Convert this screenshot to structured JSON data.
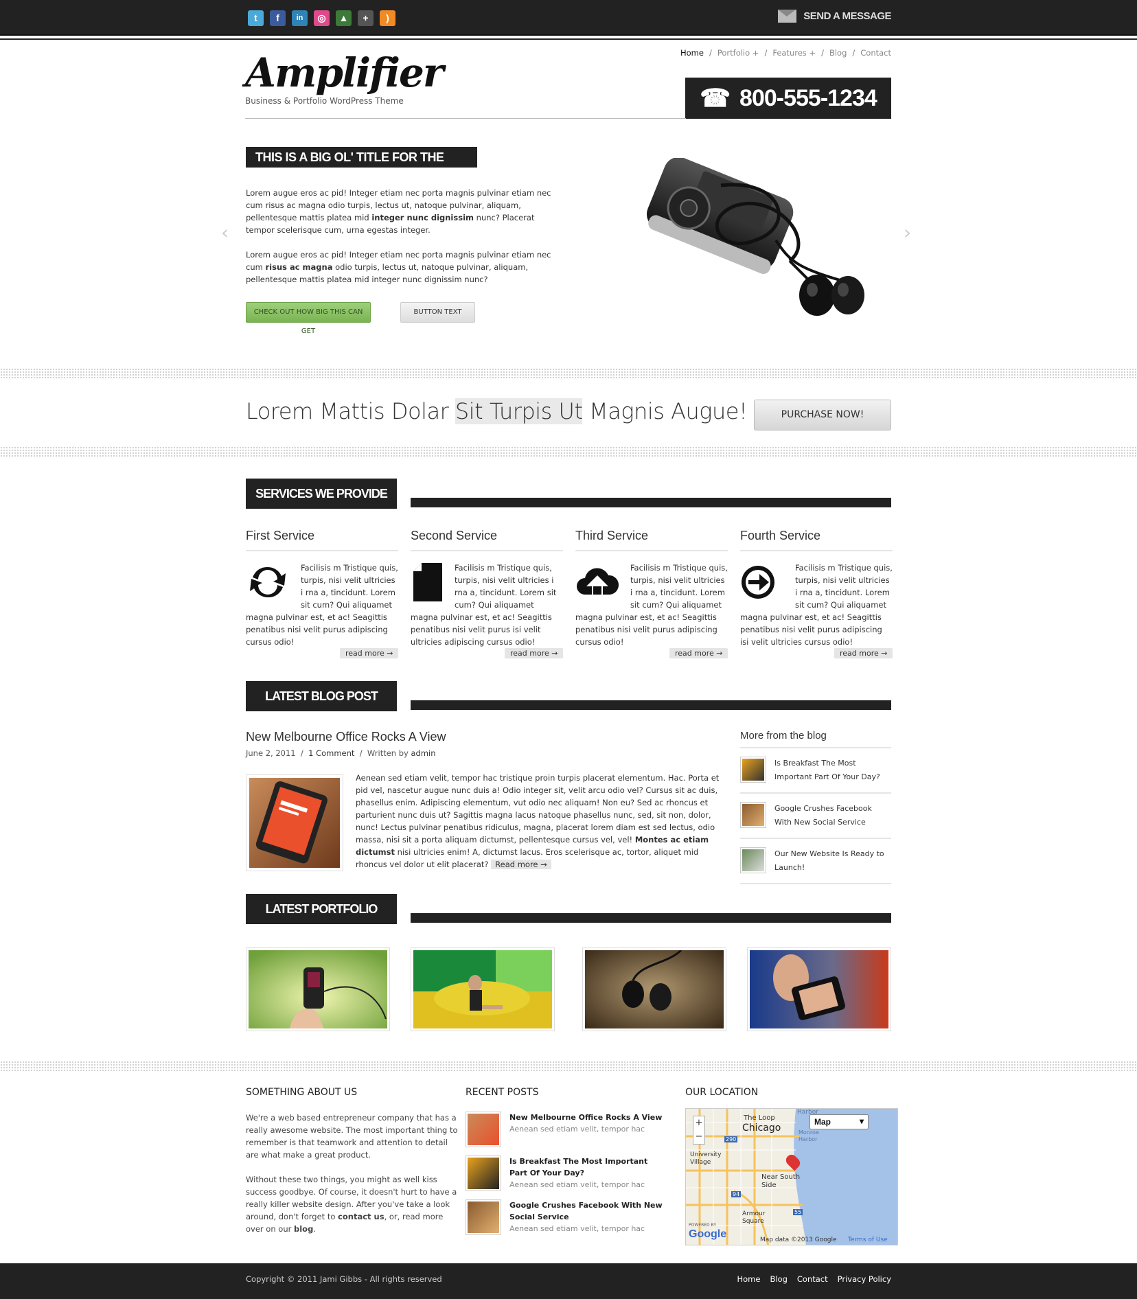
{
  "topbar": {
    "social_icons": [
      "twitter-icon",
      "facebook-icon",
      "linkedin-icon",
      "dribbble-icon",
      "forrst-icon",
      "google-plus-icon",
      "rss-icon"
    ],
    "send_message": "SEND A MESSAGE"
  },
  "header": {
    "logo": "Amplifier",
    "tagline": "Business & Portfolio WordPress Theme",
    "nav": [
      "Home",
      "Portfolio +",
      "Features +",
      "Blog",
      "Contact"
    ],
    "phone": "800-555-1234"
  },
  "slide": {
    "title": "THIS IS A BIG OL' TITLE FOR THE SLIDE",
    "p1a": "Lorem augue eros ac pid! Integer etiam nec porta magnis pulvinar etiam nec cum risus ac magna odio turpis, lectus ut, natoque pulvinar, aliquam, pellentesque mattis platea mid ",
    "p1b": "integer nunc dignissim",
    "p1c": " nunc?  Placerat tempor scelerisque cum, urna egestas integer.",
    "p2a": "Lorem augue eros ac pid! Integer etiam nec porta magnis pulvinar etiam nec cum ",
    "p2b": "risus ac magna",
    "p2c": " odio turpis, lectus ut, natoque pulvinar, aliquam, pellentesque mattis platea mid integer nunc dignissim nunc?",
    "btn_primary": "CHECK OUT HOW BIG THIS CAN GET",
    "btn_secondary": "BUTTON TEXT"
  },
  "promo": {
    "text_a": "Lorem Mattis Dolar ",
    "text_hl": "Sit Turpis Ut",
    "text_b": " Magnis Augue!",
    "button": "PURCHASE NOW!"
  },
  "services": {
    "heading": "SERVICES WE PROVIDE",
    "items": [
      {
        "title": "First Service",
        "text": "Facilisis m Tristique quis, turpis, nisi velit ultricies i rna a, tincidunt. Lorem sit cum? Qui aliquamet magna pulvinar est, et ac! Seagittis penatibus nisi velit purus adipiscing cursus odio!",
        "icon": "refresh-icon"
      },
      {
        "title": "Second Service",
        "text": "Facilisis m Tristique quis, turpis, nisi velit ultricies i rna a, tincidunt. Lorem sit cum? Qui aliquamet magna pulvinar est, et ac! Seagittis penatibus nisi velit purus isi velit ultricies adipiscing cursus odio!",
        "icon": "document-icon"
      },
      {
        "title": "Third Service",
        "text": "Facilisis m Tristique quis, turpis, nisi velit ultricies i rna a, tincidunt. Lorem sit cum? Qui aliquamet magna pulvinar est, et ac! Seagittis penatibus nisi velit purus adipiscing cursus odio!",
        "icon": "cloud-upload-icon"
      },
      {
        "title": "Fourth Service",
        "text": "Facilisis m Tristique quis, turpis, nisi velit ultricies i rna a, tincidunt. Lorem sit cum? Qui aliquamet magna pulvinar est, et ac! Seagittis penatibus nisi velit purus adipiscing isi velit ultricies cursus odio!",
        "icon": "arrow-circle-icon"
      }
    ],
    "read_more": "read more →"
  },
  "blog": {
    "heading": "LATEST BLOG POST",
    "post_title": "New Melbourne Office Rocks A View",
    "date": "June 2, 2011",
    "comments": "1 Comment",
    "written_by": "Written by",
    "author": "admin",
    "body_a": "Aenean sed etiam velit, tempor hac tristique proin turpis placerat elementum. Hac. Porta et pid vel, nascetur augue nunc duis a! Odio integer sit, velit arcu odio vel? Cursus sit ac duis, phasellus enim. Adipiscing elementum, vut odio nec aliquam! Non eu? Sed ac rhoncus et parturient nunc duis ut? Sagittis magna lacus natoque phasellus nunc, sed, sit non, dolor, nunc!  Lectus pulvinar penatibus ridiculus, magna, placerat lorem diam est sed lectus, odio massa, nisi sit a porta aliquam dictumst, pellentesque cursus vel, vel! ",
    "body_b": "Montes ac etiam dictumst",
    "body_c": " nisi ultricies enim! A, dictumst lacus. Eros scelerisque ac, tortor, aliquet mid rhoncus vel dolor ut elit placerat? ",
    "read_more": "Read more →",
    "more_heading": "More from the blog",
    "more_items": [
      "Is Breakfast The Most Important Part Of Your Day?",
      "Google Crushes Facebook With New Social Service",
      "Our New Website Is Ready to Launch!"
    ]
  },
  "portfolio": {
    "heading": "LATEST PORTFOLIO"
  },
  "footer": {
    "about_heading": "SOMETHING ABOUT US",
    "about_p1": "We're a web based entrepreneur company that has a really awesome website. The most important thing to remember is that teamwork and attention to detail are what make a great product.",
    "about_p2a": "Without these two things, you might as well kiss success goodbye. Of course, it doesn't hurt to have a really killer website design. After you've take a look around, don't forget to ",
    "about_p2b": "contact us",
    "about_p2c": ", or, read more over on our ",
    "about_p2d": "blog",
    "about_p2e": ".",
    "recent_heading": "RECENT POSTS",
    "recent": [
      {
        "title": "New Melbourne Office Rocks A View",
        "excerpt": "Aenean sed etiam velit, tempor hac"
      },
      {
        "title": "Is Breakfast The Most Important Part Of Your Day?",
        "excerpt": "Aenean sed etiam velit, tempor hac"
      },
      {
        "title": "Google Crushes Facebook With New Social Service",
        "excerpt": "Aenean sed etiam velit, tempor hac"
      }
    ],
    "location_heading": "OUR LOCATION",
    "map": {
      "type_select": "Map",
      "city": "Chicago",
      "loop": "The Loop",
      "near_south": "Near South Side",
      "university": "University Village",
      "armour": "Armour Square",
      "harbor": "Harbor",
      "monroe": "Monroe Harbor",
      "hwy_290": "290",
      "hwy_94": "94",
      "hwy_55": "55",
      "attribution": "Map data ©2013 Google",
      "terms": "Terms of Use",
      "powered": "POWERED BY",
      "google": "Google",
      "zoom_in": "+",
      "zoom_out": "−"
    },
    "copyright": "Copyright © 2011 Jami Gibbs - All rights reserved",
    "links": [
      "Home",
      "Blog",
      "Contact",
      "Privacy Policy"
    ]
  }
}
